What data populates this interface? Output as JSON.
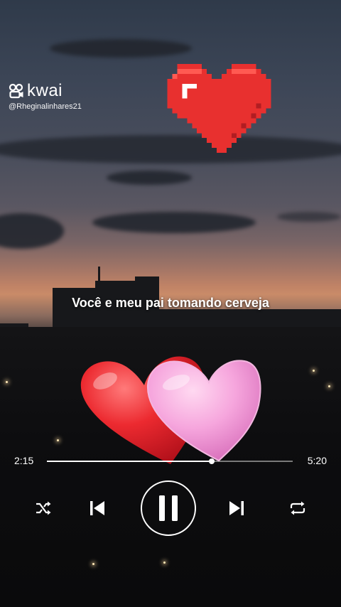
{
  "brand": {
    "name": "kwai",
    "handle": "@Rheginalinhares21",
    "icon": "kwai-logo-icon"
  },
  "lyric": {
    "text": "Você e meu pai tomando cerveja"
  },
  "player": {
    "current_time": "2:15",
    "total_time": "5:20",
    "progress_fraction": 0.67,
    "buttons": {
      "shuffle": "shuffle-icon",
      "previous": "skip-previous-icon",
      "play_pause": "pause-icon",
      "next": "skip-next-icon",
      "repeat": "repeat-icon"
    }
  },
  "colors": {
    "pixel_heart": "#e8302f",
    "red_heart": "#e4232b",
    "pink_heart": "#f29bd6"
  }
}
